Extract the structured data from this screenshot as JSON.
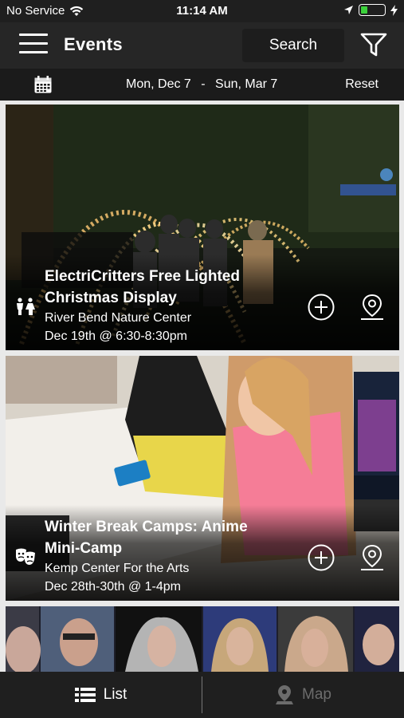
{
  "status_bar": {
    "carrier": "No Service",
    "time": "11:14 AM"
  },
  "header": {
    "title": "Events",
    "search_label": "Search"
  },
  "date_bar": {
    "start": "Mon, Dec 7",
    "separator": "-",
    "end": "Sun, Mar 7",
    "reset_label": "Reset"
  },
  "events": [
    {
      "title_line1": "ElectriCritters Free Lighted",
      "title_line2": "Christmas Display",
      "venue": "River Bend Nature Center",
      "when": "Dec 19th @ 6:30-8:30pm",
      "category_icon": "family-icon"
    },
    {
      "title_line1": "Winter Break Camps: Anime",
      "title_line2": "Mini-Camp",
      "venue": "Kemp Center For the Arts",
      "when": "Dec 28th-30th @ 1-4pm",
      "category_icon": "theater-masks-icon"
    }
  ],
  "tabs": {
    "list_label": "List",
    "map_label": "Map"
  },
  "colors": {
    "header_bg": "#262626",
    "date_bar_bg": "#1b1b1b",
    "tab_active": "#ffffff",
    "tab_inactive": "#6c6c6c",
    "battery": "#3bd13b"
  }
}
